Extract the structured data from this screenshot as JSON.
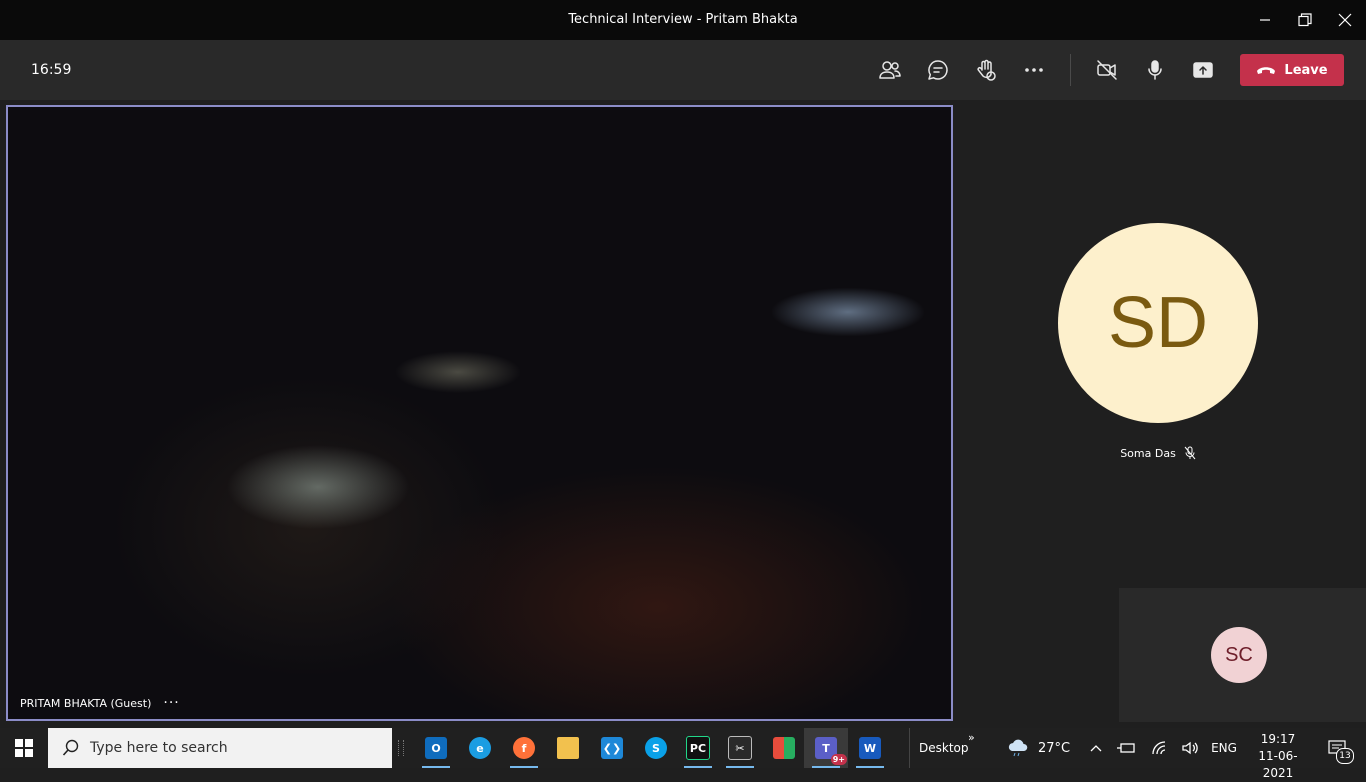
{
  "window": {
    "title": "Technical Interview - Pritam Bhakta"
  },
  "toolbar": {
    "timer": "16:59",
    "leave_label": "Leave",
    "icons": [
      "participants-icon",
      "chat-icon",
      "raise-hand-icon",
      "more-actions-icon",
      "camera-off-icon",
      "microphone-icon",
      "share-screen-icon",
      "phone-hangup-icon"
    ],
    "leave_color": "#c4314b"
  },
  "video": {
    "participant_label": "PRITAM BHAKTA (Guest)",
    "more_label": "···",
    "border_color": "#8b8cc7"
  },
  "participants": {
    "main": {
      "initials": "SD",
      "name": "Soma Das",
      "muted": true,
      "avatar_bg": "#fdf0cc"
    },
    "small": {
      "initials": "SC",
      "avatar_bg": "#f1d2d4"
    }
  },
  "taskbar": {
    "search_placeholder": "Type here to search",
    "apps": [
      "outlook-icon",
      "edge-icon",
      "firefox-icon",
      "file-explorer-icon",
      "vscode-icon",
      "skype-icon",
      "pycharm-icon",
      "snipping-tool-icon",
      "office-icon",
      "teams-icon",
      "word-icon"
    ],
    "teams_badge": "9+",
    "desktop_label": "Desktop",
    "desktop_chevron": "»",
    "weather_temp": "27°C",
    "language": "ENG",
    "time": "19:17",
    "date": "11-06-2021",
    "notification_count": "13"
  }
}
